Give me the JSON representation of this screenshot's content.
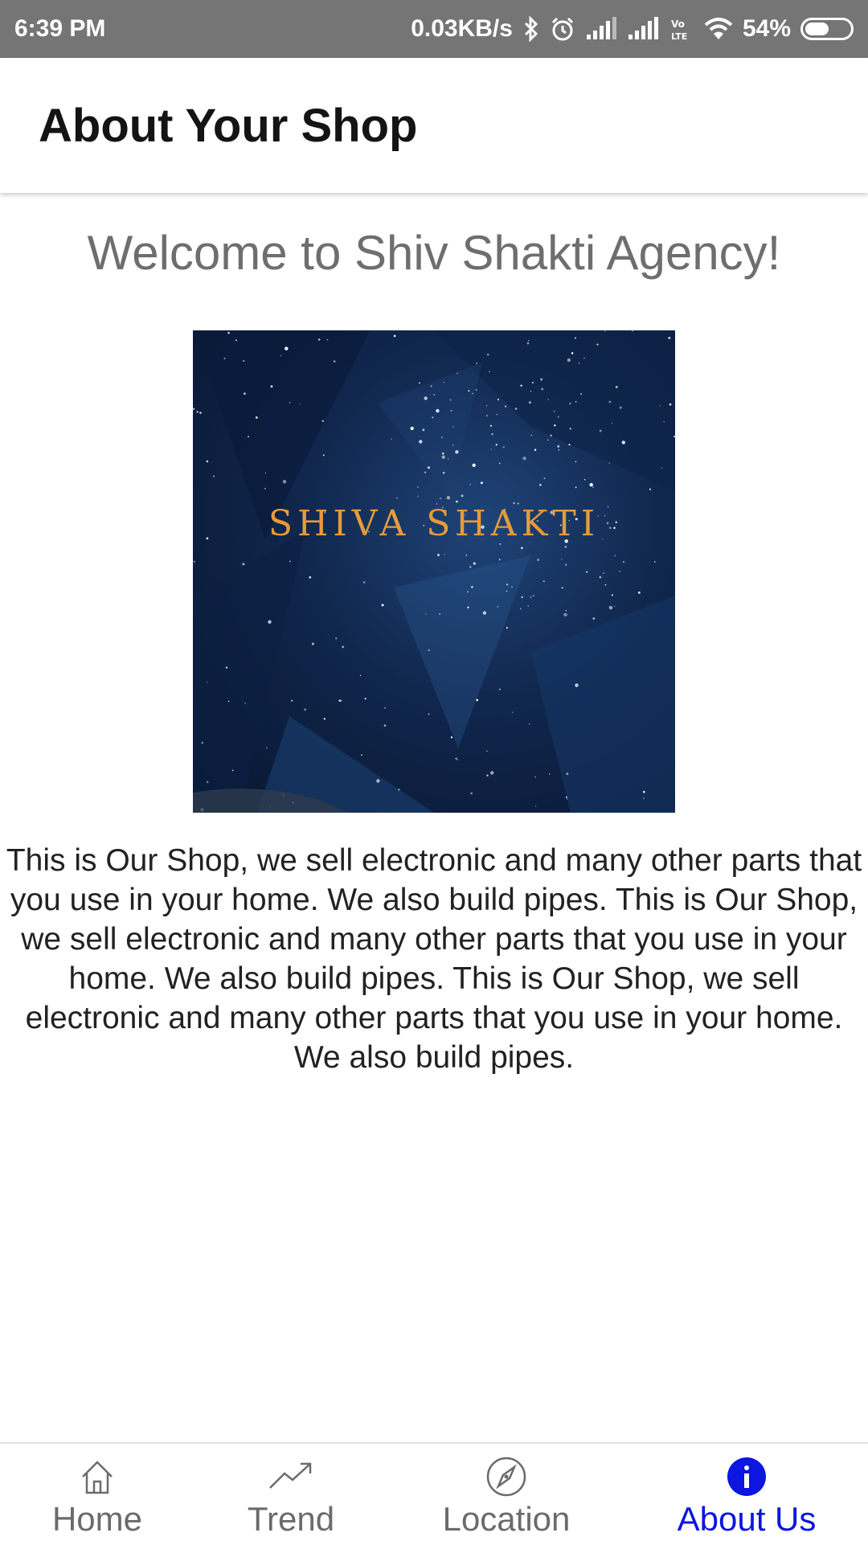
{
  "status_bar": {
    "time": "6:39 PM",
    "net_speed": "0.03KB/s",
    "battery": "54%",
    "battery_level": 0.54,
    "icons": [
      "bluetooth-icon",
      "alarm-icon",
      "signal-icon",
      "signal-icon",
      "volte-icon",
      "wifi-icon",
      "battery-icon"
    ]
  },
  "app_bar": {
    "title": "About Your Shop"
  },
  "main": {
    "welcome": "Welcome to Shiv Shakti Agency!",
    "image_logo_text": "SHIVA SHAKTI",
    "description": "This is Our Shop, we sell electronic and many other parts that you use in your home. We also build pipes. This is Our Shop, we sell electronic and many other parts that you use in your home. We also build pipes. This is Our Shop, we sell electronic and many other parts that you use in your home. We also build pipes."
  },
  "bottom_nav": {
    "items": [
      {
        "label": "Home",
        "icon": "home-icon"
      },
      {
        "label": "Trend",
        "icon": "trend-icon"
      },
      {
        "label": "Location",
        "icon": "compass-icon"
      },
      {
        "label": "About Us",
        "icon": "info-icon",
        "active": true
      }
    ]
  },
  "colors": {
    "status_bar": "#757575",
    "active_nav": "#0c16e0",
    "inactive_nav": "#6b6b6b",
    "logo_text": "#e69b3a"
  }
}
